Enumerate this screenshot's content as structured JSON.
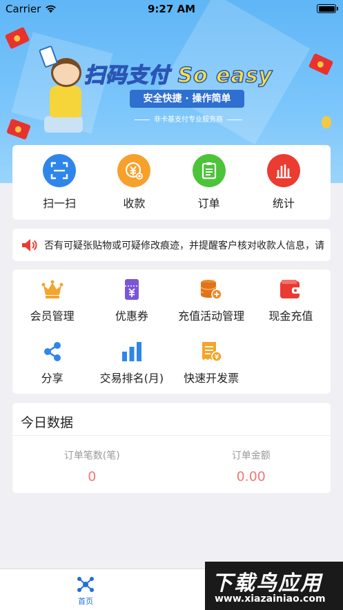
{
  "status_bar": {
    "carrier": "Carrier",
    "time": "9:27 AM"
  },
  "banner": {
    "slogan_main": "扫码支付 So easy",
    "slogan_sub": "安全快捷 · 操作简单",
    "tagline": "非卡基支付专业服务商"
  },
  "quick_actions": [
    {
      "label": "扫一扫",
      "icon": "scan-icon",
      "color": "#2f86ea"
    },
    {
      "label": "收款",
      "icon": "yuan-coin-icon",
      "color": "#f7a12c"
    },
    {
      "label": "订单",
      "icon": "clipboard-icon",
      "color": "#4cc43a"
    },
    {
      "label": "统计",
      "icon": "bar-chart-icon",
      "color": "#ec3b30"
    }
  ],
  "notice": {
    "icon": "speaker-icon",
    "text": "否有可疑张贴物或可疑修改痕迹，并提醒客户核对收款人信息，请"
  },
  "tools": [
    {
      "label": "会员管理",
      "icon": "crown-icon",
      "color": "#f4a52a"
    },
    {
      "label": "优惠券",
      "icon": "coupon-icon",
      "color": "#7a55d8"
    },
    {
      "label": "充值活动管理",
      "icon": "coins-stack-icon",
      "color": "#f08a24"
    },
    {
      "label": "现金充值",
      "icon": "wallet-icon",
      "color": "#ea3b33"
    },
    {
      "label": "分享",
      "icon": "share-icon",
      "color": "#2f86ea"
    },
    {
      "label": "交易排名(月)",
      "icon": "ranking-bars-icon",
      "color": "#2f86ea"
    },
    {
      "label": "快速开发票",
      "icon": "invoice-icon",
      "color": "#f4a52a"
    }
  ],
  "today": {
    "title": "今日数据",
    "order_count_label": "订单笔数(笔)",
    "order_count_value": "0",
    "order_amount_label": "订单金额",
    "order_amount_value": "0.00"
  },
  "tab_bar": {
    "home_label": "首页",
    "home_icon": "network-icon",
    "active_color": "#1f6fd8"
  },
  "watermark": {
    "title": "下载鸟应用",
    "url": "www.xiazainiao.com"
  }
}
